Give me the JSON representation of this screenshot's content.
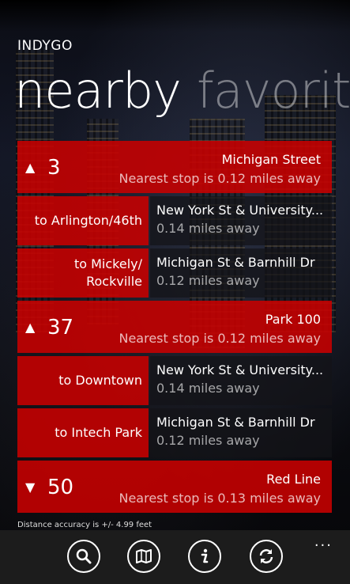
{
  "app": {
    "name": "INDYGO"
  },
  "pivot": {
    "active": "nearby",
    "next": "favorite"
  },
  "routes": [
    {
      "arrow": "▲",
      "number": "3",
      "name": "Michigan Street",
      "nearest": "Nearest stop is 0.12 miles away",
      "stops": [
        {
          "direction": "to Arlington/46th",
          "stop": "New York St & University...",
          "distance": "0.14 miles away"
        },
        {
          "direction": "to Mickely/ Rockville",
          "stop": "Michigan St & Barnhill Dr",
          "distance": "0.12 miles away"
        }
      ]
    },
    {
      "arrow": "▲",
      "number": "37",
      "name": "Park 100",
      "nearest": "Nearest stop is 0.12 miles away",
      "stops": [
        {
          "direction": "to Downtown",
          "stop": "New York St & University...",
          "distance": "0.14 miles away"
        },
        {
          "direction": "to Intech Park",
          "stop": "Michigan St & Barnhill Dr",
          "distance": "0.12 miles away"
        }
      ]
    },
    {
      "arrow": "▼",
      "number": "50",
      "name": "Red Line",
      "nearest": "Nearest stop is 0.13 miles away",
      "stops": []
    }
  ],
  "accuracy": "Distance accuracy is +/- 4.99 feet",
  "appbar": {
    "buttons": [
      "search-icon",
      "map-icon",
      "info-icon",
      "refresh-icon"
    ],
    "more": "..."
  }
}
